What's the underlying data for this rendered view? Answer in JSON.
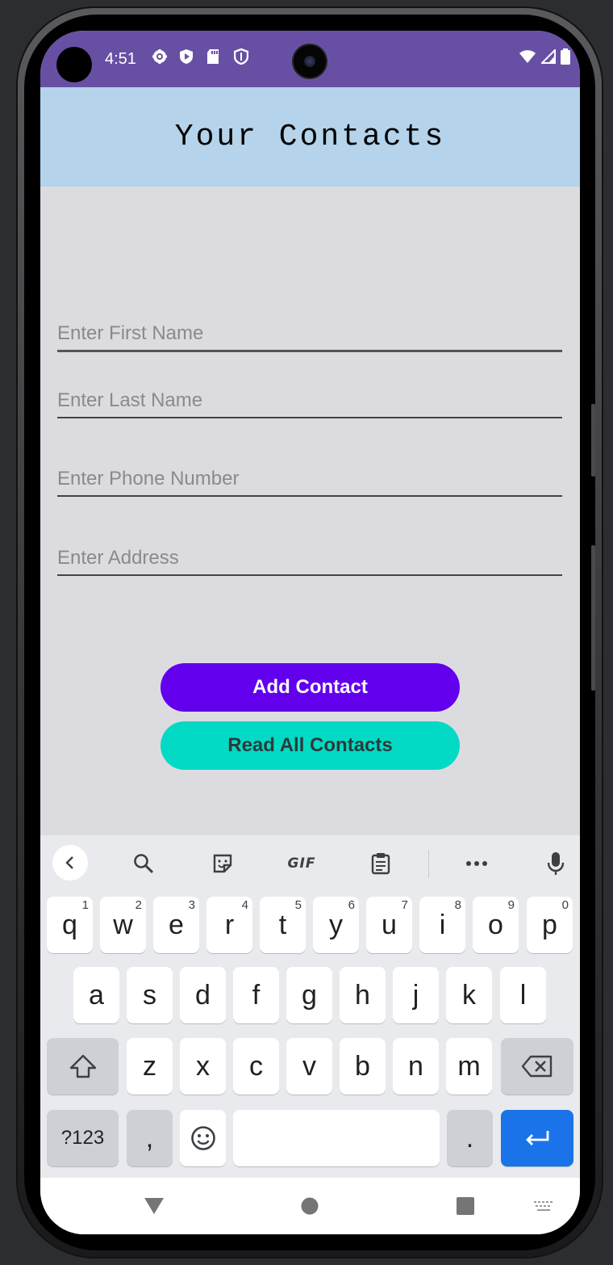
{
  "status_bar": {
    "time": "4:51",
    "left_icons": [
      "gear-icon",
      "shield-play-icon",
      "sd-card-icon",
      "shield-outline-icon"
    ],
    "right_icons": [
      "wifi-icon",
      "signal-icon",
      "battery-icon"
    ]
  },
  "app_bar": {
    "title": "Your Contacts"
  },
  "form": {
    "first_name": {
      "value": "",
      "placeholder": "Enter First Name"
    },
    "last_name": {
      "value": "",
      "placeholder": "Enter Last Name"
    },
    "phone": {
      "value": "",
      "placeholder": "Enter Phone Number"
    },
    "address": {
      "value": "",
      "placeholder": "Enter Address"
    }
  },
  "buttons": {
    "add_label": "Add Contact",
    "read_label": "Read All Contacts"
  },
  "keyboard": {
    "toolbar_gif_label": "GIF",
    "row1": [
      {
        "key": "q",
        "hint": "1"
      },
      {
        "key": "w",
        "hint": "2"
      },
      {
        "key": "e",
        "hint": "3"
      },
      {
        "key": "r",
        "hint": "4"
      },
      {
        "key": "t",
        "hint": "5"
      },
      {
        "key": "y",
        "hint": "6"
      },
      {
        "key": "u",
        "hint": "7"
      },
      {
        "key": "i",
        "hint": "8"
      },
      {
        "key": "o",
        "hint": "9"
      },
      {
        "key": "p",
        "hint": "0"
      }
    ],
    "row2": [
      "a",
      "s",
      "d",
      "f",
      "g",
      "h",
      "j",
      "k",
      "l"
    ],
    "row3": [
      "z",
      "x",
      "c",
      "v",
      "b",
      "n",
      "m"
    ],
    "symbols_label": "?123",
    "comma_label": ",",
    "period_label": "."
  },
  "colors": {
    "status_bar": "#6750a4",
    "app_bar": "#b5d3ea",
    "add_button": "#6200ee",
    "read_button": "#03dac5",
    "enter_key": "#1a73e8"
  }
}
